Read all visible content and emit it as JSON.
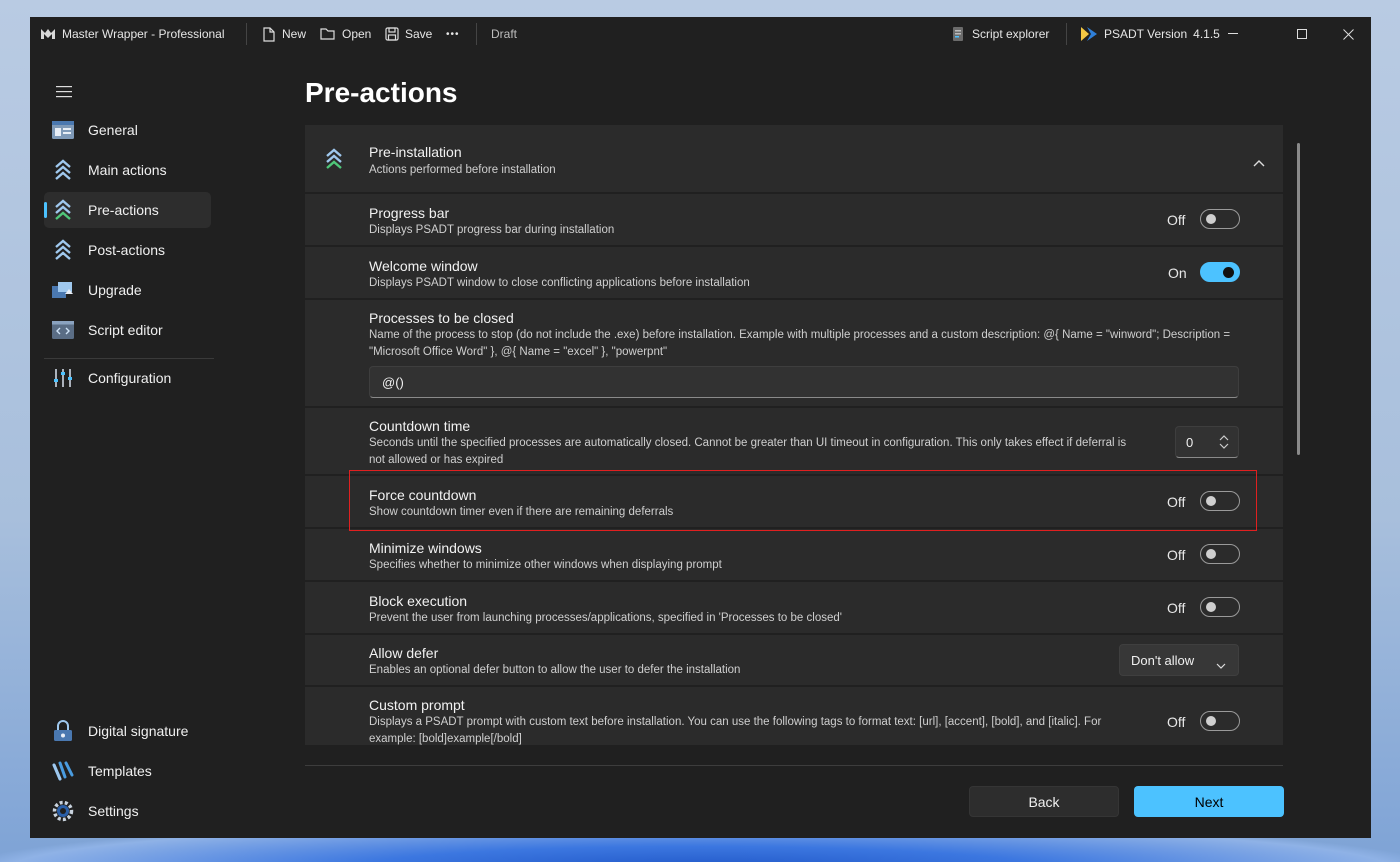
{
  "titlebar": {
    "app_title": "Master Wrapper - Professional",
    "new_label": "New",
    "open_label": "Open",
    "save_label": "Save",
    "more_label": "•••",
    "status": "Draft",
    "script_explorer_label": "Script explorer",
    "psadt_label": "PSADT Version",
    "psadt_version": "4.1.5"
  },
  "sidebar": {
    "items": [
      {
        "label": "General"
      },
      {
        "label": "Main actions"
      },
      {
        "label": "Pre-actions"
      },
      {
        "label": "Post-actions"
      },
      {
        "label": "Upgrade"
      },
      {
        "label": "Script editor"
      },
      {
        "label": "Configuration"
      }
    ],
    "bottom_items": [
      {
        "label": "Digital signature"
      },
      {
        "label": "Templates"
      },
      {
        "label": "Settings"
      }
    ],
    "active": "Pre-actions"
  },
  "page": {
    "title": "Pre-actions",
    "section": {
      "title": "Pre-installation",
      "subtitle": "Actions performed before installation"
    },
    "settings": [
      {
        "title": "Progress bar",
        "desc": "Displays PSADT progress bar during installation",
        "state": "Off"
      },
      {
        "title": "Welcome window",
        "desc": "Displays PSADT window to close conflicting applications before installation",
        "state": "On"
      },
      {
        "title": "Processes to be closed",
        "desc": "Name of the process to stop (do not include the .exe) before installation. Example with multiple processes and a custom description: @{ Name = \"winword\"; Description = \"Microsoft Office Word\" }, @{ Name = \"excel\" }, \"powerpnt\"",
        "value": "@()"
      },
      {
        "title": "Countdown time",
        "desc": "Seconds until the specified processes are automatically closed. Cannot be greater than UI timeout in configuration. This only takes effect if deferral is not allowed or has expired",
        "value": "0"
      },
      {
        "title": "Force countdown",
        "desc": "Show countdown timer even if there are remaining deferrals",
        "state": "Off"
      },
      {
        "title": "Minimize windows",
        "desc": "Specifies whether to minimize other windows when displaying prompt",
        "state": "Off"
      },
      {
        "title": "Block execution",
        "desc": "Prevent the user from launching processes/applications, specified in 'Processes to be closed'",
        "state": "Off"
      },
      {
        "title": "Allow defer",
        "desc": "Enables an optional defer button to allow the user to defer the installation",
        "value": "Don't allow"
      },
      {
        "title": "Custom prompt",
        "desc": "Displays a PSADT prompt with custom text before installation. You can use the following tags to format text: [url], [accent], [bold], and [italic]. For example: [bold]example[/bold]",
        "state": "Off"
      }
    ]
  },
  "footer": {
    "back_label": "Back",
    "next_label": "Next"
  },
  "colors": {
    "accent": "#4cc2ff",
    "window_bg": "#202020",
    "card_bg": "#2b2b2b",
    "highlight": "#e02020"
  }
}
